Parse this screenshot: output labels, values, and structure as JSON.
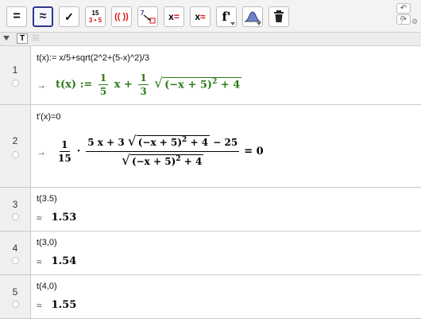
{
  "toolbar": {
    "buttons": [
      {
        "name": "evaluate-button",
        "label": "="
      },
      {
        "name": "numeric-button",
        "label": "≈",
        "selected": true
      },
      {
        "name": "keep-input-button",
        "label": "✓"
      },
      {
        "name": "factor-button",
        "label_top": "15",
        "label_bottom": "3 • 5"
      },
      {
        "name": "expand-button",
        "label": "(( ))"
      },
      {
        "name": "substitute-button",
        "label": "7"
      },
      {
        "name": "solve-button",
        "label": "x="
      },
      {
        "name": "solve-numerically-button",
        "label": "x≈"
      },
      {
        "name": "derivative-button",
        "label": "f'"
      },
      {
        "name": "probability-calculator-button",
        "label": ""
      },
      {
        "name": "delete-button",
        "label": ""
      }
    ],
    "undo_icon": "undo-icon",
    "redo_icon": "redo-icon",
    "help_icon": "help-icon",
    "settings_icon": "settings-icon"
  },
  "stylebar": {
    "text_button": "T",
    "accent": "#2d3a8c"
  },
  "colors": {
    "output_green": "#2c7a14",
    "row_number_bg": "#f0f0f0"
  },
  "rows": [
    {
      "number": "1",
      "input": "t(x):= x/5+sqrt(2^2+(5-x)^2)/3",
      "output_prefix": "→",
      "output": {
        "lhs": "t(x) :=",
        "frac1_num": "1",
        "frac1_den": "5",
        "term1": "x +",
        "frac2_num": "1",
        "frac2_den": "3",
        "radicand": "(−x + 5)",
        "exponent": "2",
        "radicand_tail": "+ 4"
      }
    },
    {
      "number": "2",
      "input": "t'(x)=0",
      "output_prefix": "→",
      "output": {
        "coef_num": "1",
        "coef_den": "15",
        "dot": "·",
        "num_lead": "5 x + 3",
        "radicand": "(−x + 5)",
        "exponent": "2",
        "radicand_tail": "+ 4",
        "num_tail": "− 25",
        "eq": "= 0"
      }
    },
    {
      "number": "3",
      "input": "t(3.5)",
      "output_prefix": "≈",
      "value": "1.53"
    },
    {
      "number": "4",
      "input": "t(3,0)",
      "output_prefix": "≈",
      "value": "1.54"
    },
    {
      "number": "5",
      "input": "t(4,0)",
      "output_prefix": "≈",
      "value": "1.55"
    }
  ]
}
